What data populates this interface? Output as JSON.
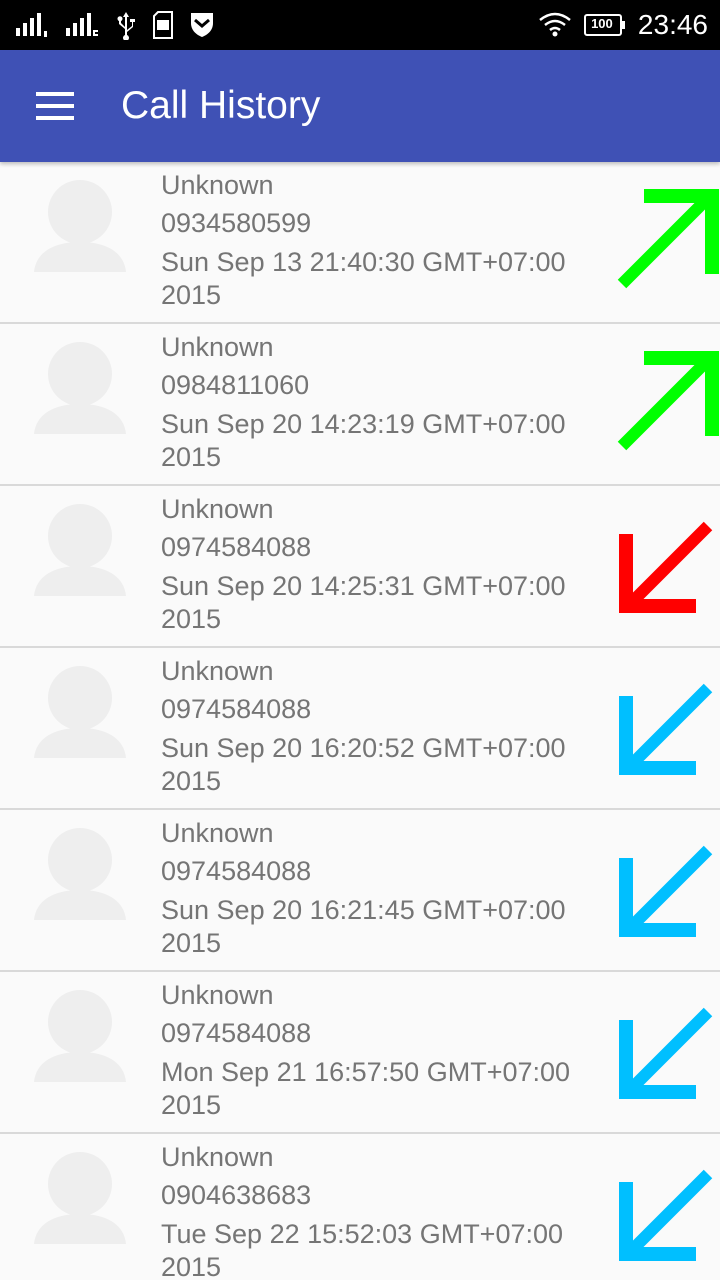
{
  "status_bar": {
    "time": "23:46",
    "battery": "100",
    "icons": [
      "signal-sim1-icon",
      "signal-sim2-icon",
      "usb-icon",
      "sd-card-icon",
      "shield-icon",
      "wifi-icon",
      "battery-icon"
    ]
  },
  "app_bar": {
    "title": "Call History",
    "menu_icon": "hamburger-menu-icon",
    "color": "#3f51b5"
  },
  "call_types": {
    "outgoing": {
      "icon": "outgoing-call-arrow-icon",
      "color": "#00ff00"
    },
    "missed": {
      "icon": "missed-call-arrow-icon",
      "color": "#ff0000"
    },
    "incoming": {
      "icon": "incoming-call-arrow-icon",
      "color": "#00bfff"
    }
  },
  "calls": [
    {
      "name": "Unknown",
      "number": "0934580599",
      "date": "Sun Sep 13 21:40:30 GMT+07:00 2015",
      "type": "outgoing"
    },
    {
      "name": "Unknown",
      "number": "0984811060",
      "date": "Sun Sep 20 14:23:19 GMT+07:00 2015",
      "type": "outgoing"
    },
    {
      "name": "Unknown",
      "number": "0974584088",
      "date": "Sun Sep 20 14:25:31 GMT+07:00 2015",
      "type": "missed"
    },
    {
      "name": "Unknown",
      "number": "0974584088",
      "date": "Sun Sep 20 16:20:52 GMT+07:00 2015",
      "type": "incoming"
    },
    {
      "name": "Unknown",
      "number": "0974584088",
      "date": "Sun Sep 20 16:21:45 GMT+07:00 2015",
      "type": "incoming"
    },
    {
      "name": "Unknown",
      "number": "0974584088",
      "date": "Mon Sep 21 16:57:50 GMT+07:00 2015",
      "type": "incoming"
    },
    {
      "name": "Unknown",
      "number": "0904638683",
      "date": "Tue Sep 22 15:52:03 GMT+07:00 2015",
      "type": "incoming"
    }
  ]
}
